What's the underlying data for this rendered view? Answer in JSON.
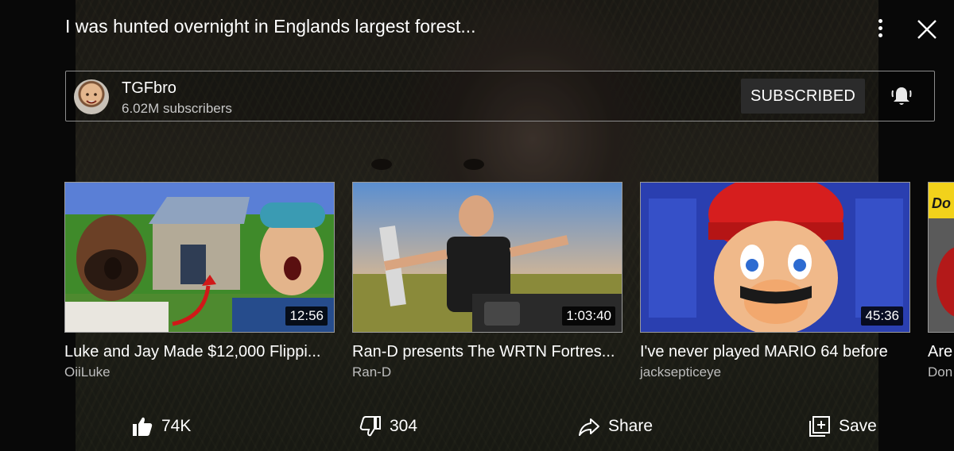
{
  "video": {
    "title": "I was hunted overnight in Englands largest forest..."
  },
  "channel": {
    "name": "TGFbro",
    "subscribers": "6.02M subscribers",
    "subscribe_label": "SUBSCRIBED"
  },
  "recommendations": [
    {
      "title": "Luke and Jay Made $12,000 Flippi...",
      "channel": "OiiLuke",
      "duration": "12:56"
    },
    {
      "title": "Ran-D presents The WRTN Fortres...",
      "channel": "Ran-D",
      "duration": "1:03:40"
    },
    {
      "title": "I've never played MARIO 64 before",
      "channel": "jacksepticeye",
      "duration": "45:36"
    },
    {
      "title": "Are",
      "channel": "Don"
    }
  ],
  "actions": {
    "like_count": "74K",
    "dislike_count": "304",
    "share_label": "Share",
    "save_label": "Save"
  },
  "icons": {
    "more": "more-vert-icon",
    "close": "close-icon",
    "bell": "bell-icon",
    "like": "thumb-up-icon",
    "dislike": "thumb-down-icon",
    "share": "share-icon",
    "save": "playlist-add-icon"
  },
  "colors": {
    "background": "#0b0b0b",
    "subscribed_button": "#2b2b2b",
    "secondary_text": "#c7c7c7"
  }
}
